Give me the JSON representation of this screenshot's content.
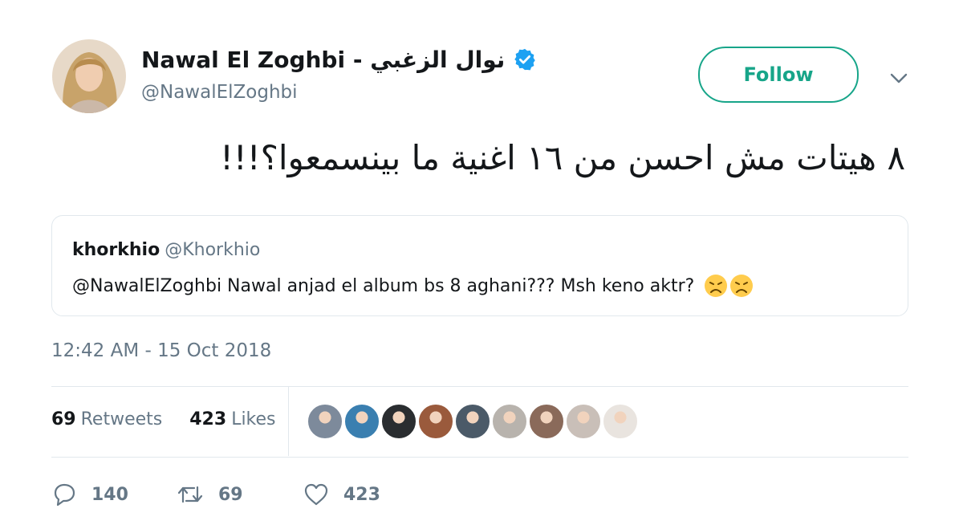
{
  "author": {
    "display_name": "Nawal El Zoghbi - نوال الزغبي",
    "handle": "@NawalElZoghbi",
    "verified": true
  },
  "follow_label": "Follow",
  "tweet": {
    "text": "٨ هيتات مش احسن من ١٦ اغنية ما بينسمعوا؟!!!",
    "timestamp": "12:42 AM - 15 Oct 2018"
  },
  "quoted_tweet": {
    "name": "khorkhio",
    "handle": "@Khorkhio",
    "text": "@NawalElZoghbi Nawal anjad el album bs 8 aghani??? Msh keno aktr?",
    "emoji": [
      "disappointed-face",
      "disappointed-face"
    ]
  },
  "stats": {
    "retweets_count": "69",
    "retweets_label": "Retweets",
    "likes_count": "423",
    "likes_label": "Likes"
  },
  "actions": {
    "reply_count": "140",
    "retweet_count": "69",
    "like_count": "423"
  },
  "likers": [
    {
      "color": "#7d8a9b"
    },
    {
      "color": "#3a7fb0"
    },
    {
      "color": "#2a2d30"
    },
    {
      "color": "#9a5a3c"
    },
    {
      "color": "#4b5a68"
    },
    {
      "color": "#b8b3ad"
    },
    {
      "color": "#8a6a5a"
    },
    {
      "color": "#c9bfb8"
    },
    {
      "color": "#e9e4df"
    }
  ],
  "colors": {
    "accent": "#17a589",
    "verified": "#1da1f2",
    "muted": "#657786",
    "border": "#e1e8ed"
  }
}
